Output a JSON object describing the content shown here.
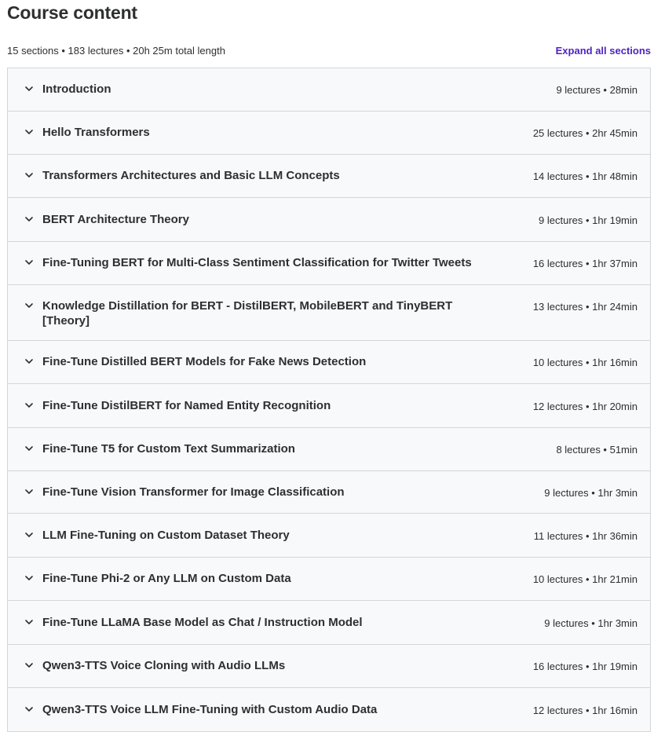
{
  "header": {
    "title": "Course content",
    "summary": "15 sections • 183 lectures • 20h 25m total length",
    "expand_label": "Expand all sections"
  },
  "icons": {
    "section_toggle": "chevron-down-icon"
  },
  "colors": {
    "accent": "#5022c3",
    "section_bg": "#f7f9fa",
    "border": "#d1d7dc",
    "text": "#2d2f31"
  },
  "sections": [
    {
      "title": "Introduction",
      "info": "9 lectures • 28min"
    },
    {
      "title": "Hello Transformers",
      "info": "25 lectures • 2hr 45min"
    },
    {
      "title": "Transformers Architectures and Basic LLM Concepts",
      "info": "14 lectures • 1hr 48min"
    },
    {
      "title": "BERT Architecture Theory",
      "info": "9 lectures • 1hr 19min"
    },
    {
      "title": "Fine-Tuning BERT for Multi-Class Sentiment Classification for Twitter Tweets",
      "info": "16 lectures • 1hr 37min"
    },
    {
      "title": "Knowledge Distillation for BERT - DistilBERT, MobileBERT and TinyBERT [Theory]",
      "info": "13 lectures • 1hr 24min"
    },
    {
      "title": "Fine-Tune Distilled BERT Models for Fake News Detection",
      "info": "10 lectures • 1hr 16min"
    },
    {
      "title": "Fine-Tune DistilBERT for Named Entity Recognition",
      "info": "12 lectures • 1hr 20min"
    },
    {
      "title": "Fine-Tune T5 for Custom Text Summarization",
      "info": "8 lectures • 51min"
    },
    {
      "title": "Fine-Tune Vision Transformer for Image Classification",
      "info": "9 lectures • 1hr 3min"
    },
    {
      "title": "LLM Fine-Tuning on Custom Dataset Theory",
      "info": "11 lectures • 1hr 36min"
    },
    {
      "title": "Fine-Tune Phi-2 or Any LLM on Custom Data",
      "info": "10 lectures • 1hr 21min"
    },
    {
      "title": "Fine-Tune LLaMA Base Model as Chat / Instruction Model",
      "info": "9 lectures • 1hr 3min"
    },
    {
      "title": "Qwen3-TTS Voice Cloning with Audio LLMs",
      "info": "16 lectures • 1hr 19min"
    },
    {
      "title": "Qwen3-TTS Voice LLM Fine-Tuning with Custom Audio Data",
      "info": "12 lectures • 1hr 16min"
    }
  ]
}
